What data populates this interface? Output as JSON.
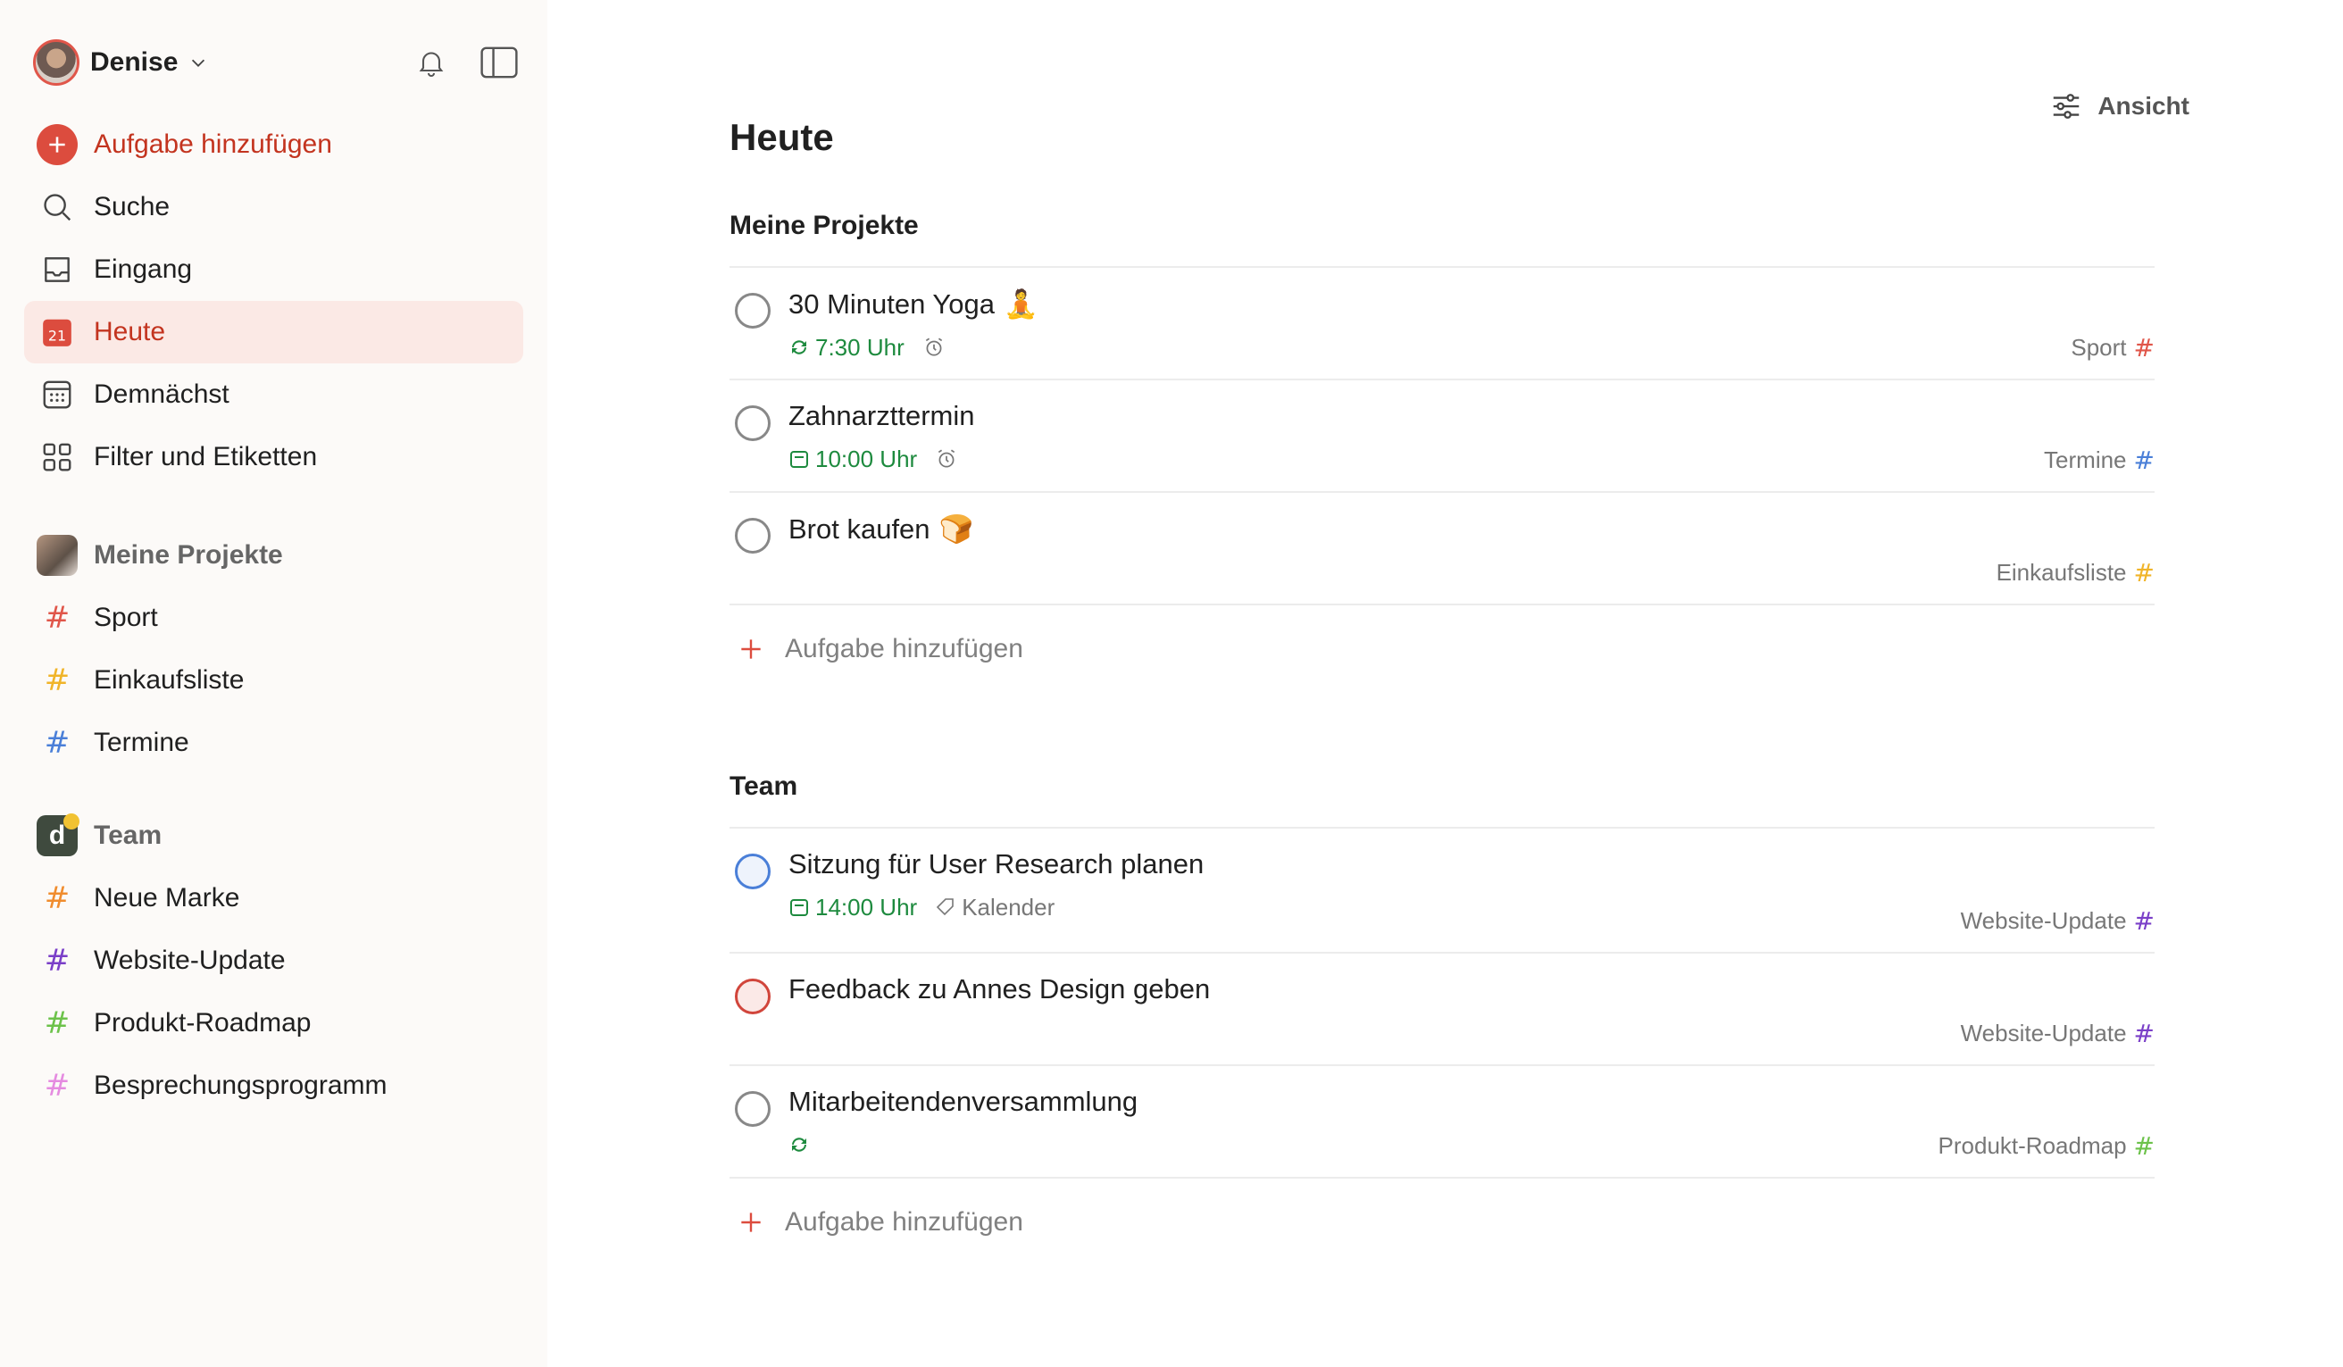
{
  "colors": {
    "accent": "#dc4c3e",
    "sport": "#e0564a",
    "einkauf": "#f0b429",
    "termine": "#4a7fd8",
    "neue_marke": "#f08c2e",
    "website": "#7a3fc8",
    "roadmap": "#6cc24a",
    "besprechung": "#e58be0",
    "date_green": "#1d8a3e"
  },
  "sidebar": {
    "user_name": "Denise",
    "nav": {
      "add": "Aufgabe hinzufügen",
      "search": "Suche",
      "inbox": "Eingang",
      "today": "Heute",
      "today_day": "21",
      "upcoming": "Demnächst",
      "filters": "Filter und Etiketten"
    },
    "my_projects": {
      "title": "Meine Projekte",
      "items": [
        {
          "label": "Sport"
        },
        {
          "label": "Einkaufsliste"
        },
        {
          "label": "Termine"
        }
      ]
    },
    "team": {
      "title": "Team",
      "avatar_letter": "d",
      "items": [
        {
          "label": "Neue Marke"
        },
        {
          "label": "Website-Update"
        },
        {
          "label": "Produkt-Roadmap"
        },
        {
          "label": "Besprechungsprogramm"
        }
      ]
    }
  },
  "main": {
    "view_label": "Ansicht",
    "title": "Heute",
    "sections": [
      {
        "title": "Meine Projekte",
        "tasks": [
          {
            "title": "30 Minuten Yoga",
            "emoji": "🧘",
            "time": "7:30 Uhr",
            "project": "Sport"
          },
          {
            "title": "Zahnarzttermin",
            "time": "10:00 Uhr",
            "project": "Termine"
          },
          {
            "title": "Brot kaufen",
            "emoji": "🍞",
            "project": "Einkaufsliste"
          }
        ],
        "add_label": "Aufgabe hinzufügen"
      },
      {
        "title": "Team",
        "tasks": [
          {
            "title": "Sitzung für User Research planen",
            "time": "14:00 Uhr",
            "label": "Kalender",
            "project": "Website-Update"
          },
          {
            "title": "Feedback zu Annes Design geben",
            "project": "Website-Update"
          },
          {
            "title": "Mitarbeitendenversammlung",
            "project": "Produkt-Roadmap"
          }
        ],
        "add_label": "Aufgabe hinzufügen"
      }
    ]
  }
}
